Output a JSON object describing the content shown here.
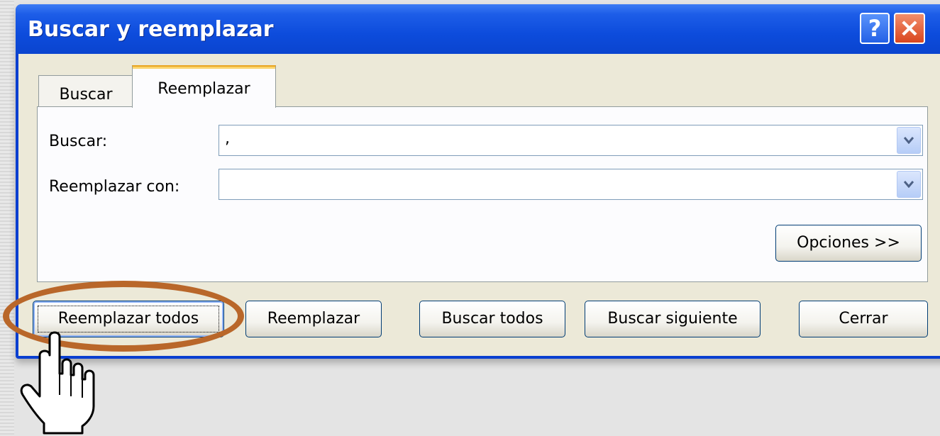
{
  "dialog": {
    "title": "Buscar y reemplazar",
    "help_label": "?",
    "close_label": "×"
  },
  "tabs": [
    {
      "label": "Buscar",
      "active": false
    },
    {
      "label": "Reemplazar",
      "active": true
    }
  ],
  "fields": {
    "find": {
      "label": "Buscar:",
      "value": ","
    },
    "replace": {
      "label": "Reemplazar con:",
      "value": ""
    }
  },
  "buttons": {
    "options": "Opciones >>",
    "replace_all": "Reemplazar todos",
    "replace": "Reemplazar",
    "find_all": "Buscar todos",
    "find_next": "Buscar siguiente",
    "close": "Cerrar"
  },
  "colors": {
    "titlebar": "#0d4cdc",
    "highlight_ring": "#b9672a",
    "active_tab_accent": "#e8a420"
  },
  "overlay": {
    "highlight": "ellipse-around-replace-all",
    "cursor": "hand-pointer-icon"
  }
}
